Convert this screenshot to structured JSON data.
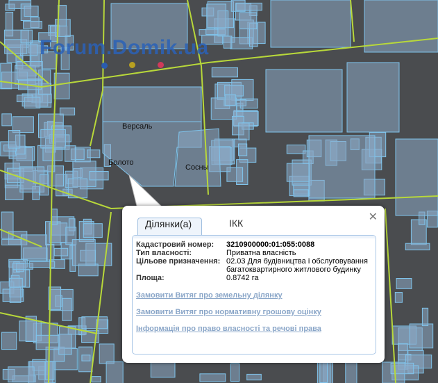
{
  "map": {
    "watermark": "Forum.Domik.ua",
    "labels": {
      "versal": "Версаль",
      "boloto": "Болото",
      "sosny": "Сосны"
    },
    "colors": {
      "background": "#4a4c4f",
      "parcel_fill": "#8aa8c4",
      "parcel_stroke": "#7fc4ec",
      "road": "#b8d83a"
    },
    "dots": [
      "#2a5cb0",
      "#b8a020",
      "#d03a5a"
    ]
  },
  "popup": {
    "tabs": [
      {
        "label": "Ділянки(а)",
        "active": true
      },
      {
        "label": "ІКК",
        "active": false
      }
    ],
    "close_icon": "close-icon",
    "fields": [
      {
        "key": "Кадастровий номер:",
        "value": "3210900000:01:055:0088",
        "bold": true
      },
      {
        "key": "Тип власності:",
        "value": "Приватна власність"
      },
      {
        "key": "Цільове призначення:",
        "value": "02.03 Для будівництва і обслуговування багатоквартирного житлового будинку"
      },
      {
        "key": "Площа:",
        "value": "0.8742 га"
      }
    ],
    "links": [
      "Замовити Витяг про земельну ділянку",
      "Замовити Витяг про нормативну грошову оцінку",
      "Інформація про право власності та речові права"
    ]
  }
}
